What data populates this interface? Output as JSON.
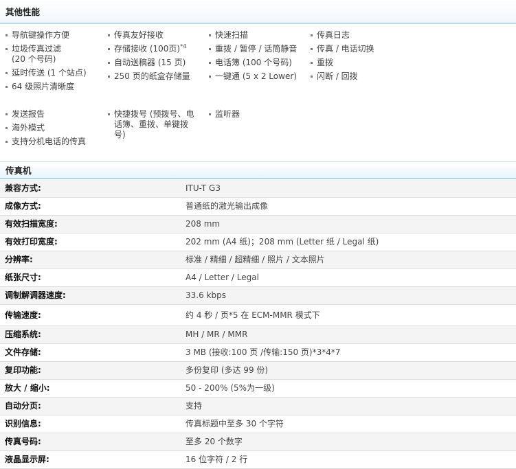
{
  "other_features": {
    "title": "其他性能",
    "groups": [
      {
        "columns": [
          [
            "导航键操作方便",
            "垃圾传真过滤|(20 个号码)",
            "延时传送 (1 个站点)",
            "64 级照片清晰度"
          ],
          [
            "传真友好接收",
            "存储接收 (100页)^*4",
            "自动送稿器 (15 页)",
            "250 页的纸盒存储量"
          ],
          [
            "快速扫描",
            "重拨 / 暂停 / 话筒静音",
            "电话簿 (100 个号码)",
            "一键通 (5 x 2 Lower)"
          ],
          [
            "传真日志",
            "传真 / 电话切换",
            "重拨",
            "闪断 / 回拨"
          ]
        ]
      },
      {
        "columns": [
          [
            "发送报告",
            "海外模式",
            "支持分机电话的传真"
          ],
          [
            "快捷拨号 (预拨号、电|话簿、重拨、单键拨|号)"
          ],
          [
            "监听器"
          ],
          []
        ]
      }
    ]
  },
  "fax": {
    "title": "传真机",
    "rows": [
      {
        "label": "兼容方式:",
        "value": "ITU-T G3"
      },
      {
        "label": "成像方式:",
        "value": "普通纸的激光输出成像"
      },
      {
        "label": "有效扫描宽度:",
        "value": "208 mm"
      },
      {
        "label": "有效打印宽度:",
        "value": "202 mm (A4 纸)；208 mm (Letter 纸 / Legal 纸)"
      },
      {
        "label": "分辨率:",
        "value": "标准 / 精细 / 超精细 / 照片 / 文本照片"
      },
      {
        "label": "纸张尺寸:",
        "value": "A4 / Letter / Legal"
      },
      {
        "label": "调制解调器速度:",
        "value": "33.6 kbps"
      },
      {
        "label": "传输速度:",
        "value": "约 4 秒 / 页*5 在 ECM-MMR 模式下",
        "tall": true
      },
      {
        "label": "压缩系统:",
        "value": "MH / MR / MMR"
      },
      {
        "label": "文件存储:",
        "value": "3 MB (接收:100 页 /传输:150 页)*3*4*7"
      },
      {
        "label": "复印功能:",
        "value": "多份复印 (多达 99 份)"
      },
      {
        "label": "放大 / 缩小:",
        "value": "50 - 200% (5%为一级)"
      },
      {
        "label": "自动分页:",
        "value": "支持"
      },
      {
        "label": "识别信息:",
        "value": "传真标题中至多 30 个字符"
      },
      {
        "label": "传真号码:",
        "value": "至多 20 个数字"
      },
      {
        "label": "液晶显示屏:",
        "value": "16 位字符 / 2 行"
      }
    ]
  }
}
